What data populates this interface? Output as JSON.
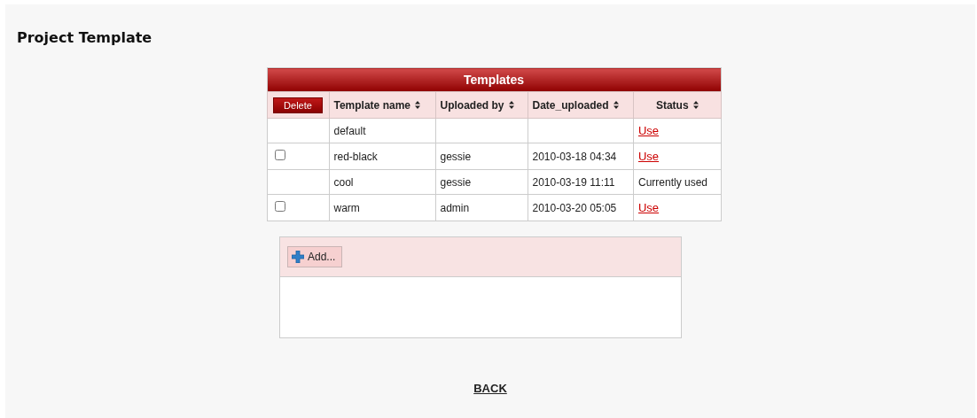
{
  "page": {
    "title": "Project Template"
  },
  "table": {
    "title": "Templates",
    "delete_button": "Delete",
    "columns": [
      {
        "label": "Template name",
        "sortable": true
      },
      {
        "label": "Uploaded by",
        "sortable": true
      },
      {
        "label": "Date_uploaded",
        "sortable": true
      },
      {
        "label": "Status",
        "sortable": true
      }
    ],
    "rows": [
      {
        "kind": "plain",
        "name": "default",
        "status": {
          "kind": "link",
          "text": "Use"
        }
      },
      {
        "kind": "checkable",
        "checked": false,
        "name": "red-black",
        "uploaded_by": "gessie",
        "date_uploaded": "2010-03-18 04:34",
        "status": {
          "kind": "link",
          "text": "Use"
        }
      },
      {
        "kind": "plain",
        "name": "cool",
        "uploaded_by": "gessie",
        "date_uploaded": "2010-03-19 11:11",
        "status": {
          "kind": "text",
          "text": "Currently used"
        }
      },
      {
        "kind": "checkable",
        "checked": false,
        "name": "warm",
        "uploaded_by": "admin",
        "date_uploaded": "2010-03-20 05:05",
        "status": {
          "kind": "link",
          "text": "Use"
        }
      }
    ]
  },
  "upload_panel": {
    "add_button": "Add..."
  },
  "back_link": "BACK"
}
